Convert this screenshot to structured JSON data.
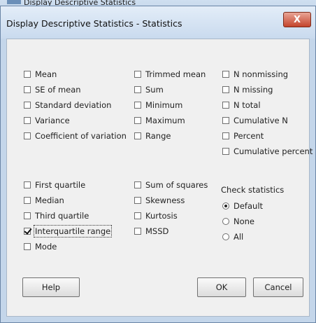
{
  "background_window": {
    "title": "Display Descriptive Statistics"
  },
  "dialog": {
    "title": "Display Descriptive Statistics - Statistics",
    "close_label": "X"
  },
  "options": {
    "mean": {
      "label": "Mean",
      "checked": false
    },
    "se_of_mean": {
      "label": "SE of mean",
      "checked": false
    },
    "standard_deviation": {
      "label": "Standard deviation",
      "checked": false
    },
    "variance": {
      "label": "Variance",
      "checked": false
    },
    "coefficient_of_variation": {
      "label": "Coefficient of variation",
      "checked": false
    },
    "trimmed_mean": {
      "label": "Trimmed mean",
      "checked": false
    },
    "sum": {
      "label": "Sum",
      "checked": false
    },
    "minimum": {
      "label": "Minimum",
      "checked": false
    },
    "maximum": {
      "label": "Maximum",
      "checked": false
    },
    "range": {
      "label": "Range",
      "checked": false
    },
    "n_nonmissing": {
      "label": "N nonmissing",
      "checked": false
    },
    "n_missing": {
      "label": "N missing",
      "checked": false
    },
    "n_total": {
      "label": "N total",
      "checked": false
    },
    "cumulative_n": {
      "label": "Cumulative N",
      "checked": false
    },
    "percent": {
      "label": "Percent",
      "checked": false
    },
    "cumulative_percent": {
      "label": "Cumulative percent",
      "checked": false
    },
    "first_quartile": {
      "label": "First quartile",
      "checked": false
    },
    "median": {
      "label": "Median",
      "checked": false
    },
    "third_quartile": {
      "label": "Third quartile",
      "checked": false
    },
    "interquartile_range": {
      "label": "Interquartile range",
      "checked": true
    },
    "mode": {
      "label": "Mode",
      "checked": false
    },
    "sum_of_squares": {
      "label": "Sum of squares",
      "checked": false
    },
    "skewness": {
      "label": "Skewness",
      "checked": false
    },
    "kurtosis": {
      "label": "Kurtosis",
      "checked": false
    },
    "mssd": {
      "label": "MSSD",
      "checked": false
    }
  },
  "check_statistics": {
    "label": "Check statistics",
    "options": [
      "Default",
      "None",
      "All"
    ],
    "selected": "Default"
  },
  "buttons": {
    "help": "Help",
    "ok": "OK",
    "cancel": "Cancel"
  }
}
